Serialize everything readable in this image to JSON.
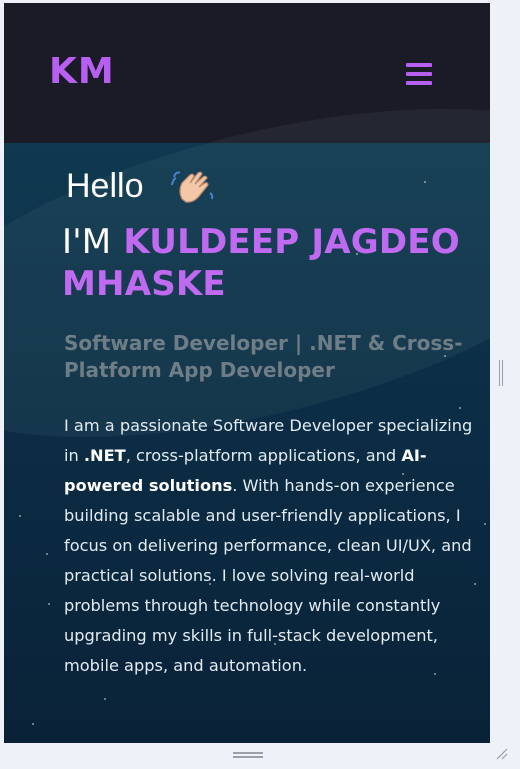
{
  "navbar": {
    "logo": "KM",
    "menu_icon": "hamburger-menu-icon"
  },
  "hero": {
    "greeting": "Hello",
    "wave_icon": "waving-hand-icon",
    "im_prefix": "I'M",
    "name": "KULDEEP JAGDEO MHASKE",
    "subtitle": "Software Developer | .NET & Cross-Platform App Developer",
    "about": {
      "p1": "I am a passionate Software Developer specializing in ",
      "net": ".NET",
      "p2": ", cross-platform applications, and ",
      "ai": "AI-powered solutions",
      "p3": ". With hands-on experience building scalable and user-friendly applications, I focus on delivering performance, clean UI/UX, and practical solutions. I love solving real-world problems through technology while constantly upgrading my skills in full-stack development, mobile apps, and automation."
    }
  },
  "colors": {
    "accent": "#b65ff0",
    "navbar_bg": "#1b1b27",
    "hero_bg": "#0b2d45"
  }
}
